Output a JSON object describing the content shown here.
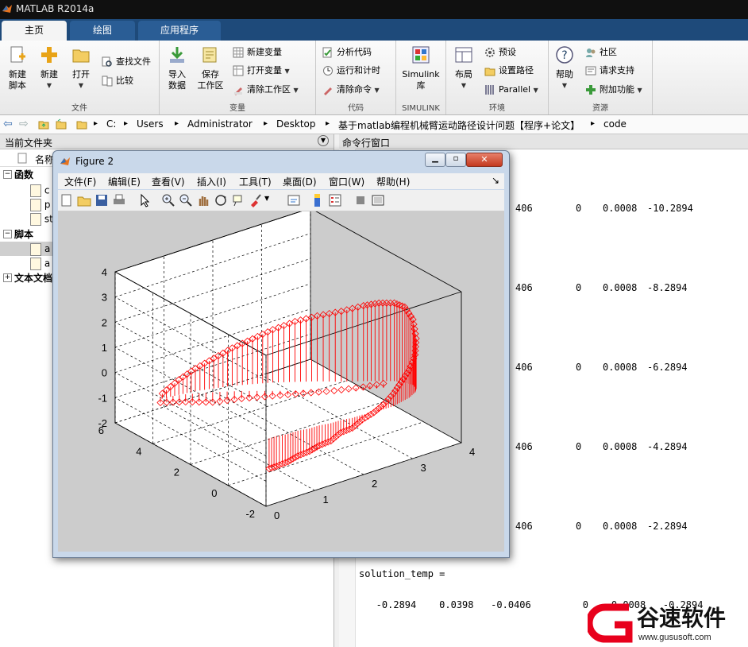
{
  "app": {
    "title": "MATLAB R2014a"
  },
  "tabs": [
    {
      "label": "主页"
    },
    {
      "label": "绘图"
    },
    {
      "label": "应用程序"
    }
  ],
  "ribbon": {
    "file": {
      "label": "文件",
      "new_script": "新建\n脚本",
      "new": "新建",
      "open": "打开",
      "find_files": "查找文件",
      "compare": "比较"
    },
    "variable": {
      "label": "变量",
      "import": "导入\n数据",
      "save_ws": "保存\n工作区",
      "new_var": "新建变量",
      "open_var": "打开变量",
      "clear_ws": "清除工作区"
    },
    "code": {
      "label": "代码",
      "analyze": "分析代码",
      "run_time": "运行和计时",
      "clear_cmd": "清除命令"
    },
    "simulink": {
      "label": "SIMULINK",
      "btn": "Simulink\n库"
    },
    "env": {
      "label": "环境",
      "layout": "布局",
      "prefs": "预设",
      "set_path": "设置路径",
      "parallel": "Parallel"
    },
    "resources": {
      "label": "资源",
      "help": "帮助",
      "community": "社区",
      "request_support": "请求支持",
      "addons": "附加功能"
    }
  },
  "address": {
    "path": [
      "C:",
      "Users",
      "Administrator",
      "Desktop",
      "基于matlab编程机械臂运动路径设计问题【程序+论文】",
      "code"
    ]
  },
  "left_panel": {
    "title": "当前文件夹",
    "column_name": "名称",
    "groups": [
      {
        "label": "函数",
        "items": [
          "c",
          "p",
          "st"
        ]
      },
      {
        "label": "脚本",
        "items": [
          "a",
          "a"
        ]
      },
      {
        "label": "文本文档",
        "items": []
      }
    ]
  },
  "command_window": {
    "title": "命令行窗口",
    "rows": [
      {
        "c1": "406",
        "c2": "0",
        "c3": "0.0008",
        "c4": "-10.2894"
      },
      {
        "c1": "406",
        "c2": "0",
        "c3": "0.0008",
        "c4": "-8.2894"
      },
      {
        "c1": "406",
        "c2": "0",
        "c3": "0.0008",
        "c4": "-6.2894"
      },
      {
        "c1": "406",
        "c2": "0",
        "c3": "0.0008",
        "c4": "-4.2894"
      },
      {
        "c1": "406",
        "c2": "0",
        "c3": "0.0008",
        "c4": "-2.2894"
      }
    ],
    "solution_label": "solution_temp =",
    "last_row": "   -0.2894    0.0398   -0.0406         0    0.0008   -0.2894"
  },
  "figure": {
    "title": "Figure 2",
    "menu": [
      "文件(F)",
      "编辑(E)",
      "查看(V)",
      "插入(I)",
      "工具(T)",
      "桌面(D)",
      "窗口(W)",
      "帮助(H)"
    ],
    "z_ticks": [
      "4",
      "3",
      "2",
      "1",
      "0",
      "-1",
      "-2"
    ],
    "y_ticks": [
      "6",
      "4",
      "2",
      "0",
      "-2"
    ],
    "x_ticks": [
      "0",
      "1",
      "2",
      "3",
      "4"
    ]
  },
  "chart_data": {
    "type": "stem3",
    "color": "#ff0000",
    "marker": "diamond",
    "grid": true,
    "xlim": [
      0,
      4
    ],
    "ylim": [
      -2,
      6
    ],
    "zlim": [
      -2,
      4
    ],
    "series": [
      {
        "x": [
          0.0,
          0.3,
          0.6,
          0.9,
          1.2,
          1.5,
          1.8,
          2.1,
          2.4,
          2.7,
          3.0,
          3.2,
          3.4,
          3.5,
          3.55,
          3.5,
          3.4,
          3.2,
          3.0,
          2.8,
          2.6,
          2.4,
          2.2,
          2.0,
          1.8,
          1.6,
          1.4,
          1.2,
          1.0,
          0.8,
          0.6,
          0.4
        ],
        "y": [
          3.5,
          3.4,
          3.3,
          3.1,
          2.9,
          2.6,
          2.3,
          1.9,
          1.5,
          1.0,
          0.6,
          0.3,
          0.0,
          -0.3,
          -0.6,
          -0.9,
          -1.1,
          -1.3,
          -1.4,
          -1.5,
          -1.5,
          -1.5,
          -1.4,
          -1.4,
          -1.3,
          -1.3,
          -1.2,
          -1.2,
          -1.1,
          -1.1,
          -1.0,
          -1.0
        ],
        "z": [
          0.2,
          0.6,
          0.9,
          1.2,
          1.5,
          1.8,
          2.1,
          2.4,
          2.6,
          2.8,
          3.0,
          3.1,
          3.1,
          3.0,
          2.6,
          2.0,
          1.5,
          1.1,
          0.8,
          0.5,
          0.2,
          0.0,
          -0.2,
          -0.4,
          -0.5,
          -0.7,
          -0.8,
          -0.9,
          -1.0,
          -1.1,
          -1.2,
          -1.2
        ]
      },
      {
        "x": [
          0.0,
          0.4,
          0.8,
          1.2,
          1.6,
          2.0,
          2.4,
          2.8,
          3.2
        ],
        "y": [
          3.6,
          3.3,
          2.9,
          2.4,
          1.8,
          1.2,
          0.6,
          0.1,
          -0.3
        ],
        "z": [
          -0.2,
          -0.3,
          -0.4,
          -0.3,
          -0.2,
          -0.1,
          0.0,
          0.1,
          0.2
        ]
      }
    ]
  },
  "watermark": {
    "name": "谷速软件",
    "url": "www.gususoft.com"
  }
}
